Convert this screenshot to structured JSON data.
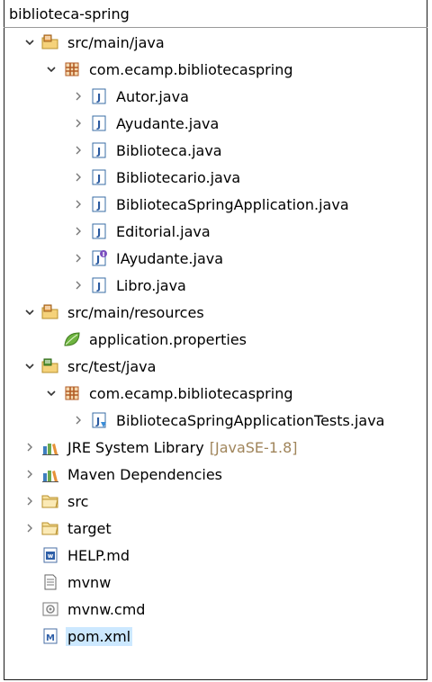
{
  "project": {
    "title": "biblioteca-spring"
  },
  "tree": [
    {
      "label": "src/main/java",
      "level": 1,
      "twisty": "expanded",
      "icon": "source-folder-icon"
    },
    {
      "label": "com.ecamp.bibliotecaspring",
      "level": 2,
      "twisty": "expanded",
      "icon": "package-icon"
    },
    {
      "label": "Autor.java",
      "level": 3,
      "twisty": "collapsed",
      "icon": "java-file-icon"
    },
    {
      "label": "Ayudante.java",
      "level": 3,
      "twisty": "collapsed",
      "icon": "java-file-icon"
    },
    {
      "label": "Biblioteca.java",
      "level": 3,
      "twisty": "collapsed",
      "icon": "java-file-icon"
    },
    {
      "label": "Bibliotecario.java",
      "level": 3,
      "twisty": "collapsed",
      "icon": "java-file-icon"
    },
    {
      "label": "BibliotecaSpringApplication.java",
      "level": 3,
      "twisty": "collapsed",
      "icon": "java-file-icon"
    },
    {
      "label": "Editorial.java",
      "level": 3,
      "twisty": "collapsed",
      "icon": "java-file-icon"
    },
    {
      "label": "IAyudante.java",
      "level": 3,
      "twisty": "collapsed",
      "icon": "java-interface-file-icon"
    },
    {
      "label": "Libro.java",
      "level": 3,
      "twisty": "collapsed",
      "icon": "java-file-icon"
    },
    {
      "label": "src/main/resources",
      "level": 1,
      "twisty": "expanded",
      "icon": "source-folder-icon"
    },
    {
      "label": "application.properties",
      "level": 2,
      "twisty": "none",
      "icon": "spring-leaf-icon"
    },
    {
      "label": "src/test/java",
      "level": 1,
      "twisty": "expanded",
      "icon": "test-source-folder-icon"
    },
    {
      "label": "com.ecamp.bibliotecaspring",
      "level": 2,
      "twisty": "expanded",
      "icon": "package-icon"
    },
    {
      "label": "BibliotecaSpringApplicationTests.java",
      "level": 3,
      "twisty": "collapsed",
      "icon": "java-test-file-icon"
    },
    {
      "label": "JRE System Library",
      "decoration": "[JavaSE-1.8]",
      "level": 1,
      "twisty": "collapsed",
      "icon": "library-icon"
    },
    {
      "label": "Maven Dependencies",
      "level": 1,
      "twisty": "collapsed",
      "icon": "library-icon"
    },
    {
      "label": "src",
      "level": 1,
      "twisty": "collapsed",
      "icon": "folder-icon"
    },
    {
      "label": "target",
      "level": 1,
      "twisty": "collapsed",
      "icon": "folder-icon"
    },
    {
      "label": "HELP.md",
      "level": 1,
      "twisty": "none",
      "icon": "markdown-file-icon"
    },
    {
      "label": "mvnw",
      "level": 1,
      "twisty": "none",
      "icon": "text-file-icon"
    },
    {
      "label": "mvnw.cmd",
      "level": 1,
      "twisty": "none",
      "icon": "cmd-file-icon"
    },
    {
      "label": "pom.xml",
      "level": 1,
      "twisty": "none",
      "icon": "maven-pom-icon",
      "selected": true
    }
  ]
}
